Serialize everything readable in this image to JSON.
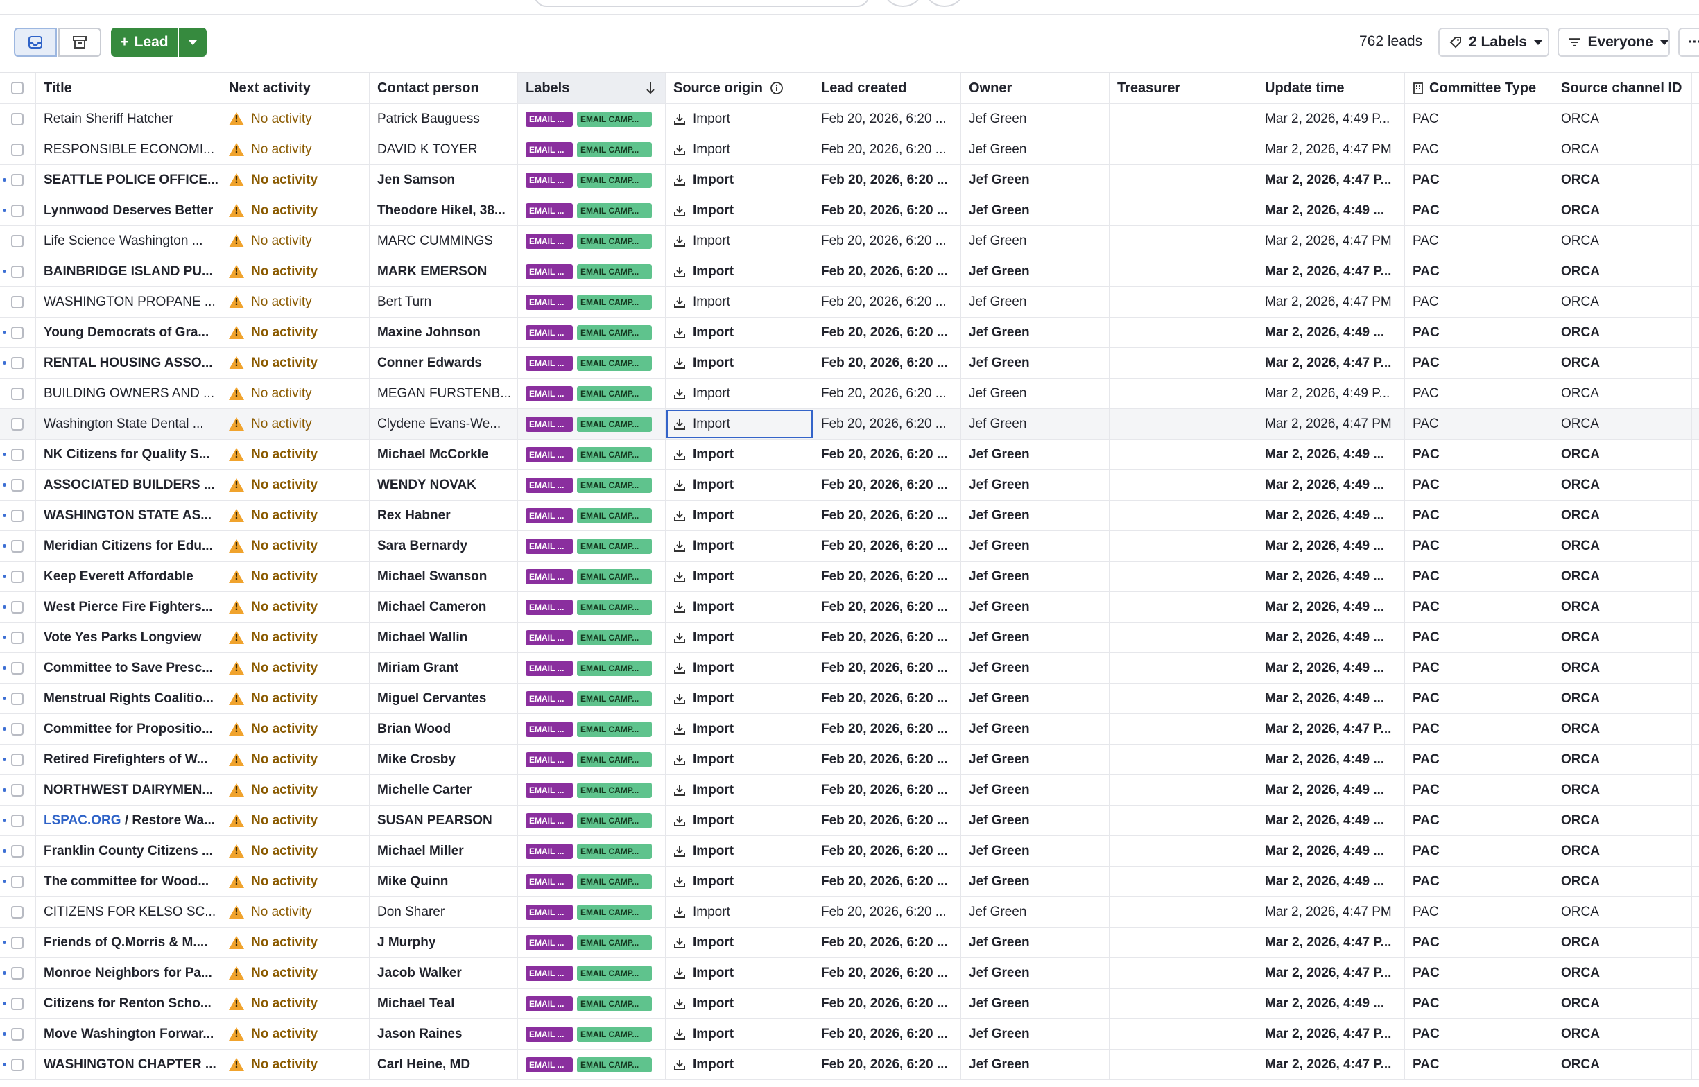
{
  "toolbar": {
    "add_label": "Lead",
    "count": "762 leads",
    "labels_filter": "2 Labels",
    "owner_filter": "Everyone",
    "more": "···"
  },
  "columns": [
    "Title",
    "Next activity",
    "Contact person",
    "Labels",
    "Source origin",
    "Lead created",
    "Owner",
    "Treasurer",
    "Update time",
    "Committee Type",
    "Source channel ID"
  ],
  "label_chips": {
    "first": "EMAIL ...",
    "second": "EMAIL CAMP..."
  },
  "rows": [
    {
      "title": "Retain Sheriff Hatcher",
      "activity": "No activity",
      "contact": "Patrick Bauguess",
      "source": "Import",
      "created": "Feb 20, 2026, 6:20 ...",
      "owner": "Jef Green",
      "treasurer": "",
      "updated": "Mar 2, 2026, 4:49 P...",
      "type": "PAC",
      "channel": "ORCA",
      "bold": false
    },
    {
      "title": "RESPONSIBLE ECONOMI...",
      "activity": "No activity",
      "contact": "DAVID K TOYER",
      "source": "Import",
      "created": "Feb 20, 2026, 6:20 ...",
      "owner": "Jef Green",
      "treasurer": "",
      "updated": "Mar 2, 2026, 4:47 PM",
      "type": "PAC",
      "channel": "ORCA",
      "bold": false
    },
    {
      "title": "SEATTLE POLICE OFFICE...",
      "activity": "No activity",
      "contact": "Jen Samson",
      "source": "Import",
      "created": "Feb 20, 2026, 6:20 ...",
      "owner": "Jef Green",
      "treasurer": "",
      "updated": "Mar 2, 2026, 4:47 P...",
      "type": "PAC",
      "channel": "ORCA",
      "bold": true
    },
    {
      "title": "Lynnwood Deserves Better",
      "activity": "No activity",
      "contact": "Theodore Hikel, 38...",
      "source": "Import",
      "created": "Feb 20, 2026, 6:20 ...",
      "owner": "Jef Green",
      "treasurer": "",
      "updated": "Mar 2, 2026, 4:49 ...",
      "type": "PAC",
      "channel": "ORCA",
      "bold": true
    },
    {
      "title": "Life Science Washington ...",
      "activity": "No activity",
      "contact": "MARC CUMMINGS",
      "source": "Import",
      "created": "Feb 20, 2026, 6:20 ...",
      "owner": "Jef Green",
      "treasurer": "",
      "updated": "Mar 2, 2026, 4:47 PM",
      "type": "PAC",
      "channel": "ORCA",
      "bold": false
    },
    {
      "title": "BAINBRIDGE ISLAND PU...",
      "activity": "No activity",
      "contact": "MARK EMERSON",
      "source": "Import",
      "created": "Feb 20, 2026, 6:20 ...",
      "owner": "Jef Green",
      "treasurer": "",
      "updated": "Mar 2, 2026, 4:47 P...",
      "type": "PAC",
      "channel": "ORCA",
      "bold": true
    },
    {
      "title": "WASHINGTON PROPANE ...",
      "activity": "No activity",
      "contact": "Bert Turn",
      "source": "Import",
      "created": "Feb 20, 2026, 6:20 ...",
      "owner": "Jef Green",
      "treasurer": "",
      "updated": "Mar 2, 2026, 4:47 PM",
      "type": "PAC",
      "channel": "ORCA",
      "bold": false
    },
    {
      "title": "Young Democrats of Gra...",
      "activity": "No activity",
      "contact": "Maxine Johnson",
      "source": "Import",
      "created": "Feb 20, 2026, 6:20 ...",
      "owner": "Jef Green",
      "treasurer": "",
      "updated": "Mar 2, 2026, 4:49 ...",
      "type": "PAC",
      "channel": "ORCA",
      "bold": true
    },
    {
      "title": "RENTAL HOUSING ASSO...",
      "activity": "No activity",
      "contact": "Conner Edwards",
      "source": "Import",
      "created": "Feb 20, 2026, 6:20 ...",
      "owner": "Jef Green",
      "treasurer": "",
      "updated": "Mar 2, 2026, 4:47 P...",
      "type": "PAC",
      "channel": "ORCA",
      "bold": true
    },
    {
      "title": "BUILDING OWNERS AND ...",
      "activity": "No activity",
      "contact": "MEGAN FURSTENB...",
      "source": "Import",
      "created": "Feb 20, 2026, 6:20 ...",
      "owner": "Jef Green",
      "treasurer": "",
      "updated": "Mar 2, 2026, 4:49 P...",
      "type": "PAC",
      "channel": "ORCA",
      "bold": false
    },
    {
      "title": "Washington State Dental ...",
      "activity": "No activity",
      "contact": "Clydene Evans-We...",
      "source": "Import",
      "created": "Feb 20, 2026, 6:20 ...",
      "owner": "Jef Green",
      "treasurer": "",
      "updated": "Mar 2, 2026, 4:47 PM",
      "type": "PAC",
      "channel": "ORCA",
      "bold": false,
      "highlight": true
    },
    {
      "title": "NK Citizens for Quality S...",
      "activity": "No activity",
      "contact": "Michael McCorkle",
      "source": "Import",
      "created": "Feb 20, 2026, 6:20 ...",
      "owner": "Jef Green",
      "treasurer": "",
      "updated": "Mar 2, 2026, 4:49 ...",
      "type": "PAC",
      "channel": "ORCA",
      "bold": true
    },
    {
      "title": "ASSOCIATED BUILDERS ...",
      "activity": "No activity",
      "contact": "WENDY NOVAK",
      "source": "Import",
      "created": "Feb 20, 2026, 6:20 ...",
      "owner": "Jef Green",
      "treasurer": "",
      "updated": "Mar 2, 2026, 4:49 ...",
      "type": "PAC",
      "channel": "ORCA",
      "bold": true
    },
    {
      "title": "WASHINGTON STATE AS...",
      "activity": "No activity",
      "contact": "Rex Habner",
      "source": "Import",
      "created": "Feb 20, 2026, 6:20 ...",
      "owner": "Jef Green",
      "treasurer": "",
      "updated": "Mar 2, 2026, 4:49 ...",
      "type": "PAC",
      "channel": "ORCA",
      "bold": true
    },
    {
      "title": "Meridian Citizens for Edu...",
      "activity": "No activity",
      "contact": "Sara Bernardy",
      "source": "Import",
      "created": "Feb 20, 2026, 6:20 ...",
      "owner": "Jef Green",
      "treasurer": "",
      "updated": "Mar 2, 2026, 4:49 ...",
      "type": "PAC",
      "channel": "ORCA",
      "bold": true
    },
    {
      "title": "Keep Everett Affordable",
      "activity": "No activity",
      "contact": "Michael Swanson",
      "source": "Import",
      "created": "Feb 20, 2026, 6:20 ...",
      "owner": "Jef Green",
      "treasurer": "",
      "updated": "Mar 2, 2026, 4:49 ...",
      "type": "PAC",
      "channel": "ORCA",
      "bold": true
    },
    {
      "title": "West Pierce Fire Fighters...",
      "activity": "No activity",
      "contact": "Michael Cameron",
      "source": "Import",
      "created": "Feb 20, 2026, 6:20 ...",
      "owner": "Jef Green",
      "treasurer": "",
      "updated": "Mar 2, 2026, 4:49 ...",
      "type": "PAC",
      "channel": "ORCA",
      "bold": true
    },
    {
      "title": "Vote Yes Parks Longview",
      "activity": "No activity",
      "contact": "Michael Wallin",
      "source": "Import",
      "created": "Feb 20, 2026, 6:20 ...",
      "owner": "Jef Green",
      "treasurer": "",
      "updated": "Mar 2, 2026, 4:49 ...",
      "type": "PAC",
      "channel": "ORCA",
      "bold": true
    },
    {
      "title": "Committee to Save Presc...",
      "activity": "No activity",
      "contact": "Miriam Grant",
      "source": "Import",
      "created": "Feb 20, 2026, 6:20 ...",
      "owner": "Jef Green",
      "treasurer": "",
      "updated": "Mar 2, 2026, 4:49 ...",
      "type": "PAC",
      "channel": "ORCA",
      "bold": true
    },
    {
      "title": "Menstrual Rights Coalitio...",
      "activity": "No activity",
      "contact": "Miguel Cervantes",
      "source": "Import",
      "created": "Feb 20, 2026, 6:20 ...",
      "owner": "Jef Green",
      "treasurer": "",
      "updated": "Mar 2, 2026, 4:49 ...",
      "type": "PAC",
      "channel": "ORCA",
      "bold": true
    },
    {
      "title": "Committee for Propositio...",
      "activity": "No activity",
      "contact": "Brian Wood",
      "source": "Import",
      "created": "Feb 20, 2026, 6:20 ...",
      "owner": "Jef Green",
      "treasurer": "",
      "updated": "Mar 2, 2026, 4:47 P...",
      "type": "PAC",
      "channel": "ORCA",
      "bold": true
    },
    {
      "title": "Retired Firefighters of W...",
      "activity": "No activity",
      "contact": "Mike Crosby",
      "source": "Import",
      "created": "Feb 20, 2026, 6:20 ...",
      "owner": "Jef Green",
      "treasurer": "",
      "updated": "Mar 2, 2026, 4:49 ...",
      "type": "PAC",
      "channel": "ORCA",
      "bold": true
    },
    {
      "title": "NORTHWEST DAIRYMEN...",
      "activity": "No activity",
      "contact": "Michelle Carter",
      "source": "Import",
      "created": "Feb 20, 2026, 6:20 ...",
      "owner": "Jef Green",
      "treasurer": "",
      "updated": "Mar 2, 2026, 4:49 ...",
      "type": "PAC",
      "channel": "ORCA",
      "bold": true
    },
    {
      "title": "/ Restore Wa...",
      "title_link": "LSPAC.ORG",
      "activity": "No activity",
      "contact": "SUSAN PEARSON",
      "source": "Import",
      "created": "Feb 20, 2026, 6:20 ...",
      "owner": "Jef Green",
      "treasurer": "",
      "updated": "Mar 2, 2026, 4:49 ...",
      "type": "PAC",
      "channel": "ORCA",
      "bold": true
    },
    {
      "title": "Franklin County Citizens ...",
      "activity": "No activity",
      "contact": "Michael Miller",
      "source": "Import",
      "created": "Feb 20, 2026, 6:20 ...",
      "owner": "Jef Green",
      "treasurer": "",
      "updated": "Mar 2, 2026, 4:49 ...",
      "type": "PAC",
      "channel": "ORCA",
      "bold": true
    },
    {
      "title": "The committee for Wood...",
      "activity": "No activity",
      "contact": "Mike Quinn",
      "source": "Import",
      "created": "Feb 20, 2026, 6:20 ...",
      "owner": "Jef Green",
      "treasurer": "",
      "updated": "Mar 2, 2026, 4:49 ...",
      "type": "PAC",
      "channel": "ORCA",
      "bold": true
    },
    {
      "title": "CITIZENS FOR KELSO SC...",
      "activity": "No activity",
      "contact": "Don Sharer",
      "source": "Import",
      "created": "Feb 20, 2026, 6:20 ...",
      "owner": "Jef Green",
      "treasurer": "",
      "updated": "Mar 2, 2026, 4:47 PM",
      "type": "PAC",
      "channel": "ORCA",
      "bold": false
    },
    {
      "title": "Friends of Q.Morris & M....",
      "activity": "No activity",
      "contact": "J Murphy",
      "source": "Import",
      "created": "Feb 20, 2026, 6:20 ...",
      "owner": "Jef Green",
      "treasurer": "",
      "updated": "Mar 2, 2026, 4:47 P...",
      "type": "PAC",
      "channel": "ORCA",
      "bold": true
    },
    {
      "title": "Monroe Neighbors for Pa...",
      "activity": "No activity",
      "contact": "Jacob Walker",
      "source": "Import",
      "created": "Feb 20, 2026, 6:20 ...",
      "owner": "Jef Green",
      "treasurer": "",
      "updated": "Mar 2, 2026, 4:47 P...",
      "type": "PAC",
      "channel": "ORCA",
      "bold": true
    },
    {
      "title": "Citizens for Renton Scho...",
      "activity": "No activity",
      "contact": "Michael Teal",
      "source": "Import",
      "created": "Feb 20, 2026, 6:20 ...",
      "owner": "Jef Green",
      "treasurer": "",
      "updated": "Mar 2, 2026, 4:49 ...",
      "type": "PAC",
      "channel": "ORCA",
      "bold": true
    },
    {
      "title": "Move Washington Forwar...",
      "activity": "No activity",
      "contact": "Jason Raines",
      "source": "Import",
      "created": "Feb 20, 2026, 6:20 ...",
      "owner": "Jef Green",
      "treasurer": "",
      "updated": "Mar 2, 2026, 4:47 P...",
      "type": "PAC",
      "channel": "ORCA",
      "bold": true
    },
    {
      "title": "WASHINGTON CHAPTER ...",
      "activity": "No activity",
      "contact": "Carl Heine, MD",
      "source": "Import",
      "created": "Feb 20, 2026, 6:20 ...",
      "owner": "Jef Green",
      "treasurer": "",
      "updated": "Mar 2, 2026, 4:47 P...",
      "type": "PAC",
      "channel": "ORCA",
      "bold": true
    }
  ]
}
